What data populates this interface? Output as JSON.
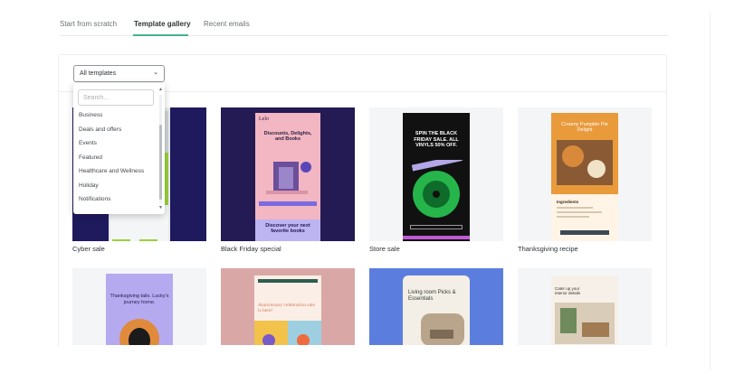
{
  "tabs": {
    "scratch": "Start from scratch",
    "gallery": "Template gallery",
    "recent": "Recent emails",
    "active": "gallery"
  },
  "filter": {
    "selected": "All templates",
    "caret_icon": "chevron-down-icon"
  },
  "dropdown": {
    "search_placeholder": "Search...",
    "items": [
      "Business",
      "Deals and offers",
      "Events",
      "Featured",
      "Healthcare and Wellness",
      "Holiday",
      "Notifications"
    ]
  },
  "templates": [
    {
      "label": "Cyber sale"
    },
    {
      "label": "Black Friday special",
      "preview": {
        "brand": "Lelo",
        "headline": "Discounts, Delights, and Books",
        "footer": "Discover your next favorite books"
      }
    },
    {
      "label": "Store sale",
      "preview": {
        "headline": "SPIN THE BLACK FRIDAY SALE. ALL VINYLS 50% OFF."
      }
    },
    {
      "label": "Thanksgiving recipe",
      "preview": {
        "headline": "Creamy Pumpkin Pie Delight",
        "section": "Ingredients"
      }
    },
    {
      "label": "",
      "preview": {
        "headline": "Thanksgiving tails. Lucky's journey home."
      }
    },
    {
      "label": "",
      "preview": {
        "headline": "Anniversary celebration sale is here!"
      }
    },
    {
      "label": "",
      "preview": {
        "headline": "Living room Picks & Essentials"
      }
    },
    {
      "label": "",
      "preview": {
        "headline": "Cater up your interior details"
      }
    }
  ],
  "colors": {
    "accent": "#45b18f",
    "black_friday_bg": "#241a54",
    "black_friday_pink": "#f3b6c3",
    "black_friday_lavender": "#bdb4f2",
    "store_sale_green": "#25b54a",
    "thanksgiving_orange": "#e99a3b",
    "lavender_card": "#b5aaf0",
    "rose_card": "#d9a8a6",
    "blue_card": "#5b7ede"
  }
}
